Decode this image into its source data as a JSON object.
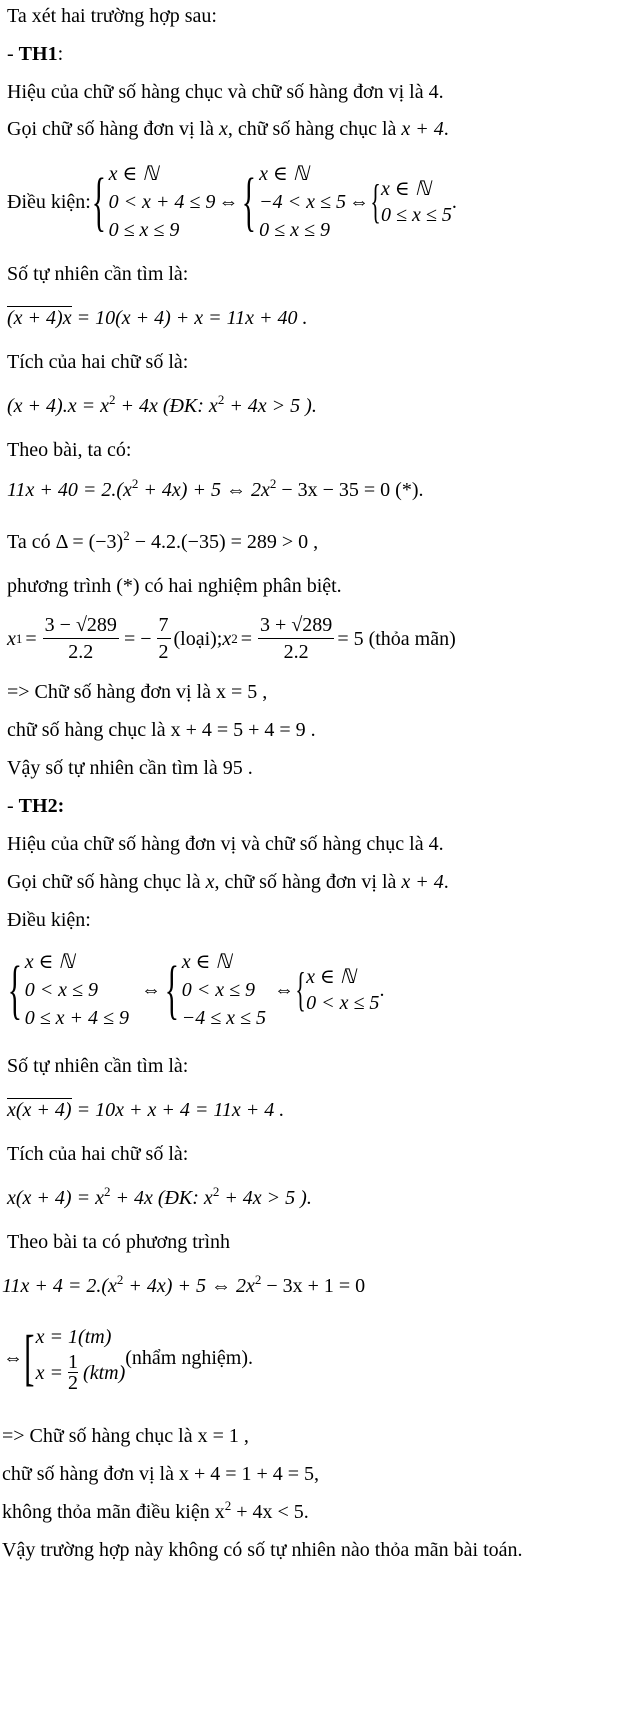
{
  "intro": "Ta xét hai trường hợp sau:",
  "case1": {
    "heading_prefix": "- ",
    "heading": "TH1",
    "heading_suffix": ":",
    "line_diff": "Hiệu của chữ số hàng chục và chữ số hàng đơn vị là 4.",
    "line_let_a": "Gọi chữ số hàng đơn vị là ",
    "let_var": "x",
    "line_let_b": ", chữ số hàng chục là ",
    "let_expr": "x + 4",
    "line_let_end": ".",
    "cond_label": "Điều kiện: ",
    "cond_sys1": [
      "x ∈ ℕ",
      "0 < x + 4 ≤ 9",
      "0 ≤ x ≤ 9"
    ],
    "cond_sys2": [
      "x ∈ ℕ",
      "−4 < x ≤ 5",
      "0 ≤ x ≤ 9"
    ],
    "cond_sys3": [
      "x ∈ ℕ",
      "0 ≤ x ≤ 5"
    ],
    "iff": "⇔",
    "period": ".",
    "number_label": "Số tự nhiên cần tìm là:",
    "number_overline": "(x + 4)x",
    "number_rest": " = 10(x + 4) + x = 11x + 40 .",
    "product_label": "Tích của hai chữ số là:",
    "product_expr": "(x + 4).x = x",
    "product_expr2": " + 4x  (ĐK: x",
    "product_expr3": " + 4x > 5 ).",
    "sq": "2",
    "theo_label": "Theo bài, ta có:",
    "eq_a": "11x + 40 = 2.(x",
    "eq_b": " + 4x) + 5 ⇔ 2x",
    "eq_c": " − 3x − 35 = 0  (*).",
    "delta_a": "Ta có  Δ = (−3)",
    "delta_b": " − 4.2.(−35) = 289 > 0 ,",
    "two_roots": "phương trình (*) có hai nghiệm phân biệt.",
    "x1_label": "x",
    "x1_sub": "1",
    "x1_num": "3 − √289",
    "x1_den": "2.2",
    "x1_val_num": "7",
    "x1_val_den": "2",
    "x1_status": " (loại);  ",
    "x2_label": "x",
    "x2_sub": "2",
    "x2_num": "3 + √289",
    "x2_den": "2.2",
    "x2_val": "= 5 (thỏa mãn)",
    "eq_sign": "=",
    "minus_eq": "= −",
    "units_result": "=> Chữ số hàng đơn vị là  x = 5 ,",
    "tens_result": "chữ số hàng chục là  x + 4 = 5 + 4 = 9 .",
    "conclusion": "Vậy số tự nhiên cần tìm là  95 ."
  },
  "case2": {
    "heading_prefix": "- ",
    "heading": "TH2:",
    "line_diff": "Hiệu của chữ số hàng đơn vị và chữ số hàng chục là 4.",
    "line_let_a": "Gọi chữ số hàng chục là ",
    "let_var": "x",
    "line_let_b": ", chữ số hàng đơn vị là ",
    "let_expr": "x + 4",
    "line_let_end": ".",
    "cond_label": "Điều kiện:",
    "cond_sys1": [
      "x ∈ ℕ",
      "0 < x ≤ 9",
      "0 ≤ x + 4 ≤ 9"
    ],
    "cond_sys2": [
      "x ∈ ℕ",
      "0 < x ≤ 9",
      "−4 ≤ x ≤ 5"
    ],
    "cond_sys3": [
      "x ∈ ℕ",
      "0 < x ≤ 5"
    ],
    "iff": "⇔",
    "period": ".",
    "number_label": "Số tự nhiên cần tìm là:",
    "number_overline": "x(x + 4)",
    "number_rest": " = 10x + x + 4 = 11x + 4 .",
    "product_label": "Tích của hai chữ số là:",
    "product_expr": "x(x + 4) = x",
    "product_expr2": " + 4x  (ĐK: x",
    "product_expr3": " + 4x > 5 ).",
    "sq": "2",
    "theo_label": "Theo bài ta có phương trình",
    "eq_a": "11x + 4 = 2.(x",
    "eq_b": " + 4x) + 5 ⇔ 2x",
    "eq_c": " − 3x + 1 = 0",
    "roots": [
      "x = 1(tm)",
      "x = "
    ],
    "root2_num": "1",
    "root2_den": "2",
    "root2_tag": "(ktm)",
    "roots_note": " (nhẩm nghiệm).",
    "tens_result": "=> Chữ số hàng chục là  x = 1  ,",
    "units_result": "chữ số hàng đơn vị là  x + 4 = 1 + 4 = 5,",
    "not_satisfy_a": "không thỏa mãn điều kiện  x",
    "not_satisfy_b": " + 4x < 5.",
    "conclusion": "Vậy trường hợp này không có số tự nhiên nào thỏa mãn bài toán."
  }
}
